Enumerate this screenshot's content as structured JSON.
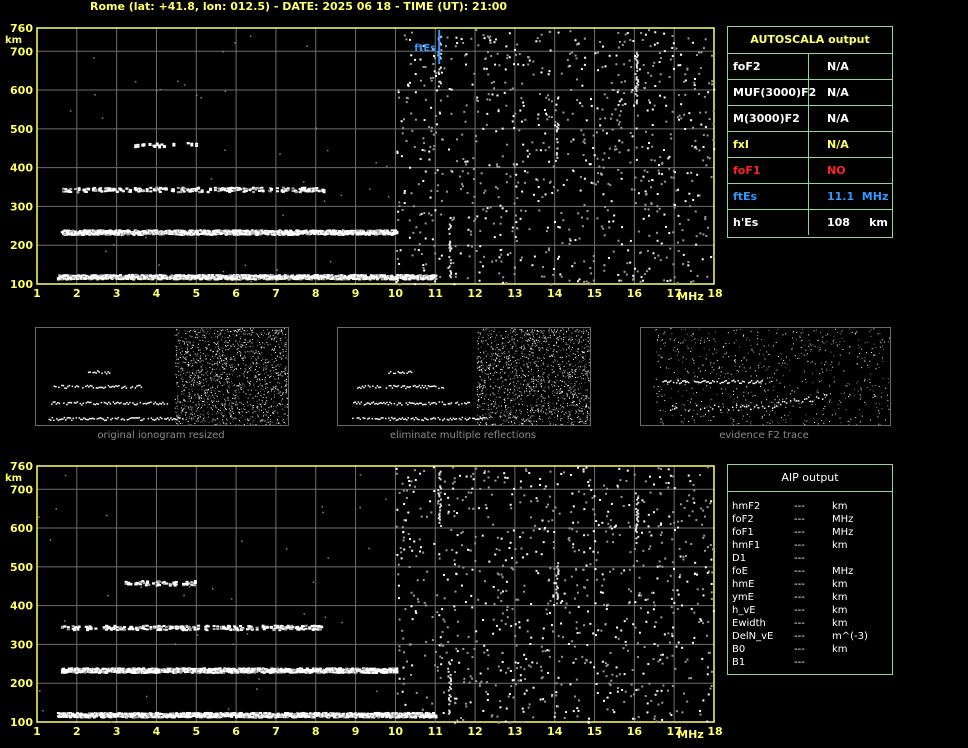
{
  "header": "Rome (lat: +41.8, lon: 012.5) - DATE: 2025 06 18 - TIME (UT): 21:00",
  "colors": {
    "yellow": "#ffff66",
    "green": "#8fd98f",
    "red": "#ff2222",
    "blue": "#3399ff",
    "grid": "#6e6e6e"
  },
  "chart_data": [
    {
      "type": "scatter",
      "name": "ionogram-top",
      "xlabel": "MHz",
      "ylabel": "km",
      "xlim": [
        1,
        18
      ],
      "ylim": [
        100,
        760
      ],
      "x_ticks": [
        1,
        2,
        3,
        4,
        5,
        6,
        7,
        8,
        9,
        10,
        11,
        12,
        13,
        14,
        15,
        16,
        17,
        18
      ],
      "y_ticks": [
        100,
        200,
        300,
        400,
        500,
        600,
        700,
        760
      ],
      "annotation": {
        "text": "ftEs",
        "x": 11.1
      },
      "traces": [
        {
          "x_start": 1.5,
          "x_end": 11.0,
          "y": 120,
          "intensity": "high"
        },
        {
          "x_start": 1.6,
          "x_end": 10.0,
          "y": 235,
          "intensity": "high"
        },
        {
          "x_start": 1.6,
          "x_end": 8.2,
          "y": 345,
          "intensity": "medium"
        },
        {
          "x_start": 3.2,
          "x_end": 5.0,
          "y": 460,
          "intensity": "low"
        }
      ]
    },
    {
      "type": "scatter",
      "name": "ionogram-bottom",
      "xlabel": "MHz",
      "ylabel": "km",
      "xlim": [
        1,
        18
      ],
      "ylim": [
        100,
        760
      ],
      "x_ticks": [
        1,
        2,
        3,
        4,
        5,
        6,
        7,
        8,
        9,
        10,
        11,
        12,
        13,
        14,
        15,
        16,
        17,
        18
      ],
      "y_ticks": [
        100,
        200,
        300,
        400,
        500,
        600,
        700,
        760
      ],
      "traces": [
        {
          "x_start": 1.5,
          "x_end": 11.0,
          "y": 120,
          "intensity": "high"
        },
        {
          "x_start": 1.6,
          "x_end": 10.0,
          "y": 235,
          "intensity": "high"
        },
        {
          "x_start": 1.6,
          "x_end": 8.2,
          "y": 345,
          "intensity": "medium"
        },
        {
          "x_start": 3.2,
          "x_end": 5.0,
          "y": 460,
          "intensity": "low"
        }
      ]
    }
  ],
  "thumbnails": [
    {
      "label": "original ionogram resized"
    },
    {
      "label": "eliminate multiple reflections"
    },
    {
      "label": "evidence F2 trace"
    }
  ],
  "autoscala": {
    "title": "AUTOSCALA output",
    "rows": [
      {
        "key": "foF2",
        "value": "N/A",
        "color": "#ffffff"
      },
      {
        "key": "MUF(3000)F2",
        "value": "N/A",
        "color": "#ffffff"
      },
      {
        "key": "M(3000)F2",
        "value": "N/A",
        "color": "#ffffff"
      },
      {
        "key": "fxI",
        "value": "N/A",
        "color": "#ffff66"
      },
      {
        "key": "foF1",
        "value": "NO",
        "color": "#ff2222"
      },
      {
        "key": "ftEs",
        "value": "11.1  MHz",
        "color": "#3399ff"
      },
      {
        "key": "h'Es",
        "value": "108     km",
        "color": "#ffffff"
      }
    ]
  },
  "aip": {
    "title": "AIP output",
    "rows": [
      {
        "key": "hmF2",
        "dash": "---",
        "unit": "km"
      },
      {
        "key": "foF2",
        "dash": "---",
        "unit": "MHz"
      },
      {
        "key": "foF1",
        "dash": "---",
        "unit": "MHz"
      },
      {
        "key": "hmF1",
        "dash": "---",
        "unit": "km"
      },
      {
        "key": "D1",
        "dash": "---",
        "unit": ""
      },
      {
        "key": "foE",
        "dash": "---",
        "unit": "MHz"
      },
      {
        "key": "hmE",
        "dash": "---",
        "unit": "km"
      },
      {
        "key": "ymE",
        "dash": "---",
        "unit": "km"
      },
      {
        "key": "h_vE",
        "dash": "---",
        "unit": "km"
      },
      {
        "key": "Ewidth",
        "dash": "---",
        "unit": "km"
      },
      {
        "key": "DelN_vE",
        "dash": "---",
        "unit": "m^(-3)"
      },
      {
        "key": "B0",
        "dash": "---",
        "unit": "km"
      },
      {
        "key": "B1",
        "dash": "---",
        "unit": ""
      }
    ]
  }
}
